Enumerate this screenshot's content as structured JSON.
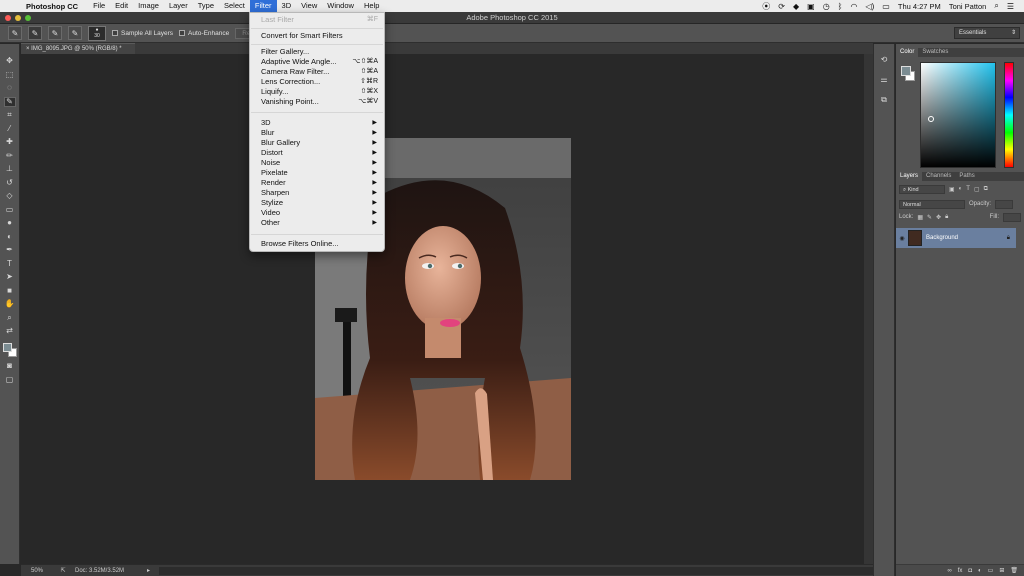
{
  "menubar": {
    "app_name": "Photoshop CC",
    "menus": [
      "File",
      "Edit",
      "Image",
      "Layer",
      "Type",
      "Select",
      "Filter",
      "3D",
      "View",
      "Window",
      "Help"
    ],
    "clock": "Thu 4:27 PM",
    "user": "Toni Patton"
  },
  "window": {
    "title": "Adobe Photoshop CC 2015",
    "document_tab": "IMG_8095.JPG @ 50% (RGB/8) *"
  },
  "options": {
    "brush_size": "30",
    "sample_all_layers": "Sample All Layers",
    "auto_enhance": "Auto-Enhance",
    "refine_edge": "Refine Edge...",
    "workspace": "Essentials"
  },
  "filter_menu": {
    "last_filter": {
      "label": "Last Filter",
      "shortcut": "⌘F"
    },
    "convert_smart": "Convert for Smart Filters",
    "group1": [
      {
        "label": "Filter Gallery...",
        "shortcut": ""
      },
      {
        "label": "Adaptive Wide Angle...",
        "shortcut": "⌥⇧⌘A"
      },
      {
        "label": "Camera Raw Filter...",
        "shortcut": "⇧⌘A"
      },
      {
        "label": "Lens Correction...",
        "shortcut": "⇧⌘R"
      },
      {
        "label": "Liquify...",
        "shortcut": "⇧⌘X"
      },
      {
        "label": "Vanishing Point...",
        "shortcut": "⌥⌘V"
      }
    ],
    "group2": [
      "3D",
      "Blur",
      "Blur Gallery",
      "Distort",
      "Noise",
      "Pixelate",
      "Render",
      "Sharpen",
      "Stylize",
      "Video",
      "Other"
    ],
    "browse_online": "Browse Filters Online..."
  },
  "status": {
    "zoom": "50%",
    "doc_size": "Doc: 3.52M/3.52M"
  },
  "color_panel": {
    "tabs": [
      "Color",
      "Swatches"
    ],
    "foreground": "#7b8c92",
    "background": "#ffffff"
  },
  "layers_panel": {
    "tabs": [
      "Layers",
      "Channels",
      "Paths"
    ],
    "filter_kind": "Kind",
    "blend_mode": "Normal",
    "opacity_label": "Opacity:",
    "lock_label": "Lock:",
    "fill_label": "Fill:",
    "layer_name": "Background"
  },
  "colors": {
    "menu_highlight": "#2f6fd8",
    "layer_selected": "#6a7f9f"
  }
}
